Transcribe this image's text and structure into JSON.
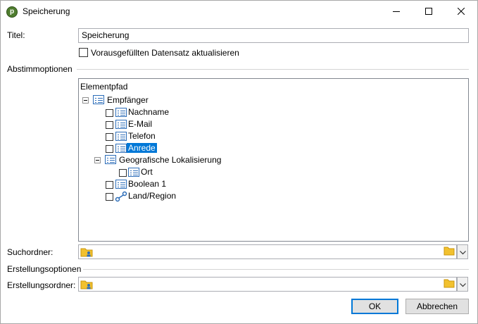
{
  "window": {
    "title": "Speicherung",
    "app_icon_glyph": "p",
    "minimize_icon": "minimize-icon",
    "maximize_icon": "maximize-icon",
    "close_icon": "close-icon"
  },
  "form": {
    "title_label": "Titel:",
    "title_value": "Speicherung",
    "update_checkbox_label": "Vorausgefüllten Datensatz aktualisieren",
    "update_checkbox_checked": false,
    "section_match": "Abstimmoptionen",
    "search_folder_label": "Suchordner:",
    "section_create": "Erstellungsoptionen",
    "create_folder_label": "Erstellungsordner:"
  },
  "tree": {
    "header": "Elementpfad",
    "root": {
      "label": "Empfänger",
      "children": [
        {
          "label": "Nachname"
        },
        {
          "label": "E-Mail"
        },
        {
          "label": "Telefon"
        },
        {
          "label": "Anrede",
          "selected": true
        },
        {
          "label": "Geografische Lokalisierung",
          "children": [
            {
              "label": "Ort"
            }
          ]
        },
        {
          "label": "Boolean 1"
        },
        {
          "label": "Land/Region"
        }
      ]
    }
  },
  "buttons": {
    "ok": "OK",
    "cancel": "Abbrechen"
  },
  "colors": {
    "selection": "#0078d7",
    "icon_blue": "#2b6cb8",
    "folder_yellow": "#f2c12e"
  }
}
